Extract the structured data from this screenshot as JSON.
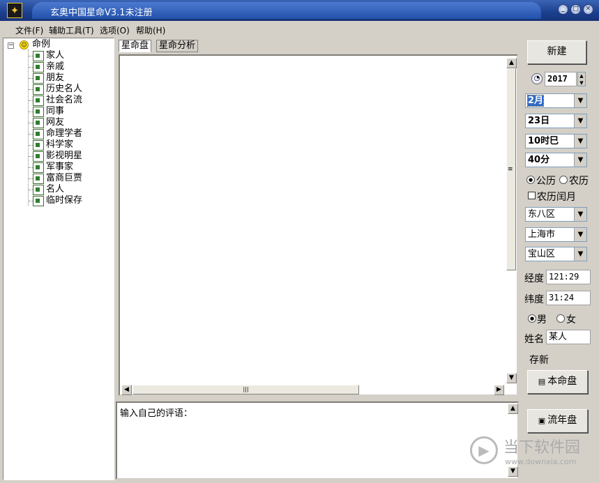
{
  "window": {
    "title": "玄奥中国星命V3.1未注册"
  },
  "menu": [
    "文件(F)",
    "辅助工具(T)",
    "选项(O)",
    "帮助(H)"
  ],
  "tree": {
    "root": "命例",
    "children": [
      "家人",
      "亲戚",
      "朋友",
      "历史名人",
      "社会名流",
      "同事",
      "网友",
      "命理学者",
      "科学家",
      "影视明星",
      "军事家",
      "富商巨贾",
      "名人",
      "临时保存"
    ]
  },
  "tabs": [
    "星命盘",
    "星命分析"
  ],
  "comment_label": "输入自己的评语：",
  "right": {
    "new_button": "新建",
    "year": "2017",
    "month": "2月",
    "day": "23日",
    "hour": "10时巳",
    "minute": "40分",
    "calendar": {
      "solar": "公历",
      "lunar": "农历",
      "selected": "公历"
    },
    "leap_month": "农历闰月",
    "timezone": "东八区",
    "city": "上海市",
    "district": "宝山区",
    "longitude_label": "经度",
    "longitude": "121:29",
    "latitude_label": "纬度",
    "latitude": "31:24",
    "gender": {
      "male": "男",
      "female": "女",
      "selected": "男"
    },
    "name_label": "姓名",
    "name": "某人",
    "save_label": "存新",
    "chart_button": "本命盘",
    "annual_button": "流年盘"
  },
  "watermark": {
    "text": "当下软件园",
    "url": "www.downxia.com"
  }
}
